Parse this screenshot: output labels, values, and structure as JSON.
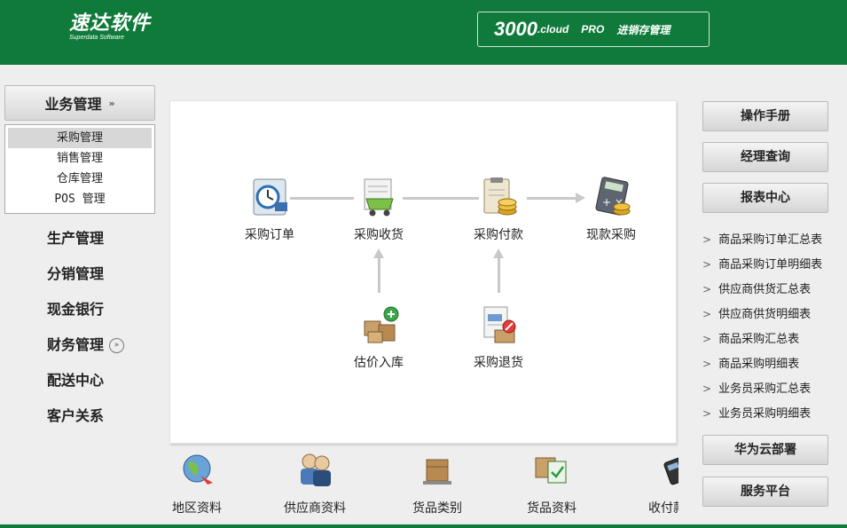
{
  "header": {
    "logo_cn": "速达软件",
    "logo_en": "Superdata Software",
    "badge_num": "3000",
    "badge_cloud": ".cloud",
    "badge_pro": "PRO",
    "badge_system": "进销存管理",
    "brand_color": "#0f7a3a"
  },
  "left_menu": {
    "active_section": "业务管理",
    "active_chevron": "»",
    "submenu": [
      "采购管理",
      "销售管理",
      "仓库管理",
      "POS 管理"
    ],
    "selected_submenu": "采购管理",
    "items": [
      "生产管理",
      "分销管理",
      "现金银行",
      "财务管理",
      "配送中心",
      "客户关系"
    ],
    "expand_icon": "chevron-down-icon"
  },
  "flow": {
    "nodes": {
      "purchase_order": "采购订单",
      "purchase_receipt": "采购收货",
      "purchase_payment": "采购付款",
      "cash_purchase": "现款采购",
      "estimated_stock_in": "估价入库",
      "purchase_return": "采购退货"
    }
  },
  "toolbar": {
    "items": [
      "地区资料",
      "供应商资料",
      "货品类别",
      "货品资料",
      "收付款"
    ]
  },
  "right_panel": {
    "buttons": [
      "操作手册",
      "经理查询",
      "报表中心"
    ],
    "reports": [
      "商品采购订单汇总表",
      "商品采购订单明细表",
      "供应商供货汇总表",
      "供应商供货明细表",
      "商品采购汇总表",
      "商品采购明细表",
      "业务员采购汇总表",
      "业务员采购明细表"
    ],
    "bottom_buttons": [
      "华为云部署",
      "服务平台"
    ]
  }
}
